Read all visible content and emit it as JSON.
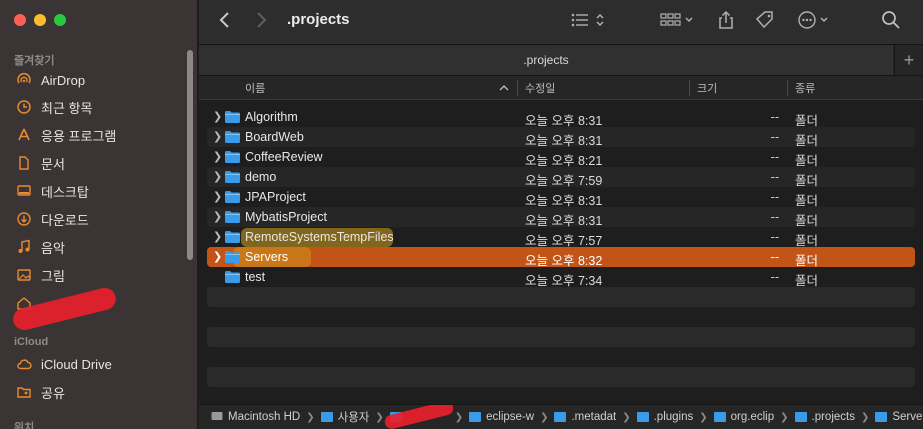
{
  "window": {
    "title": ".projects",
    "tab_label": ".projects"
  },
  "sidebar": {
    "favorites_header": "즐겨찾기",
    "favorites": [
      {
        "label": "AirDrop",
        "icon": "airdrop-icon"
      },
      {
        "label": "최근 항목",
        "icon": "clock-icon"
      },
      {
        "label": "응용 프로그램",
        "icon": "applications-icon"
      },
      {
        "label": "문서",
        "icon": "document-icon"
      },
      {
        "label": "데스크탑",
        "icon": "desktop-icon"
      },
      {
        "label": "다운로드",
        "icon": "download-icon"
      },
      {
        "label": "음악",
        "icon": "music-icon"
      },
      {
        "label": "그림",
        "icon": "pictures-icon"
      }
    ],
    "icloud_header": "iCloud",
    "icloud": [
      {
        "label": "iCloud Drive",
        "icon": "cloud-icon"
      },
      {
        "label": "공유",
        "icon": "shared-folder-icon"
      }
    ],
    "locations_header": "위치"
  },
  "columns": {
    "name": "이름",
    "date": "수정일",
    "size": "크기",
    "kind": "종류"
  },
  "files": [
    {
      "name": "Algorithm",
      "date": "오늘 오후 8:31",
      "size": "--",
      "kind": "폴더"
    },
    {
      "name": "BoardWeb",
      "date": "오늘 오후 8:31",
      "size": "--",
      "kind": "폴더"
    },
    {
      "name": "CoffeeReview",
      "date": "오늘 오후 8:21",
      "size": "--",
      "kind": "폴더"
    },
    {
      "name": "demo",
      "date": "오늘 오후 7:59",
      "size": "--",
      "kind": "폴더"
    },
    {
      "name": "JPAProject",
      "date": "오늘 오후 8:31",
      "size": "--",
      "kind": "폴더"
    },
    {
      "name": "MybatisProject",
      "date": "오늘 오후 8:31",
      "size": "--",
      "kind": "폴더"
    },
    {
      "name": "RemoteSystemsTempFiles",
      "date": "오늘 오후 7:57",
      "size": "--",
      "kind": "폴더"
    },
    {
      "name": "Servers",
      "date": "오늘 오후 8:32",
      "size": "--",
      "kind": "폴더"
    },
    {
      "name": "test",
      "date": "오늘 오후 7:34",
      "size": "--",
      "kind": "폴더"
    }
  ],
  "path": [
    "Macintosh HD",
    "사용자",
    "",
    "eclipse-w",
    ".metadat",
    ".plugins",
    "org.eclip",
    ".projects",
    "Servers"
  ],
  "colors": {
    "selection": "#c25418",
    "folder": "#3a9be8",
    "highlight": "#d4a21a"
  }
}
